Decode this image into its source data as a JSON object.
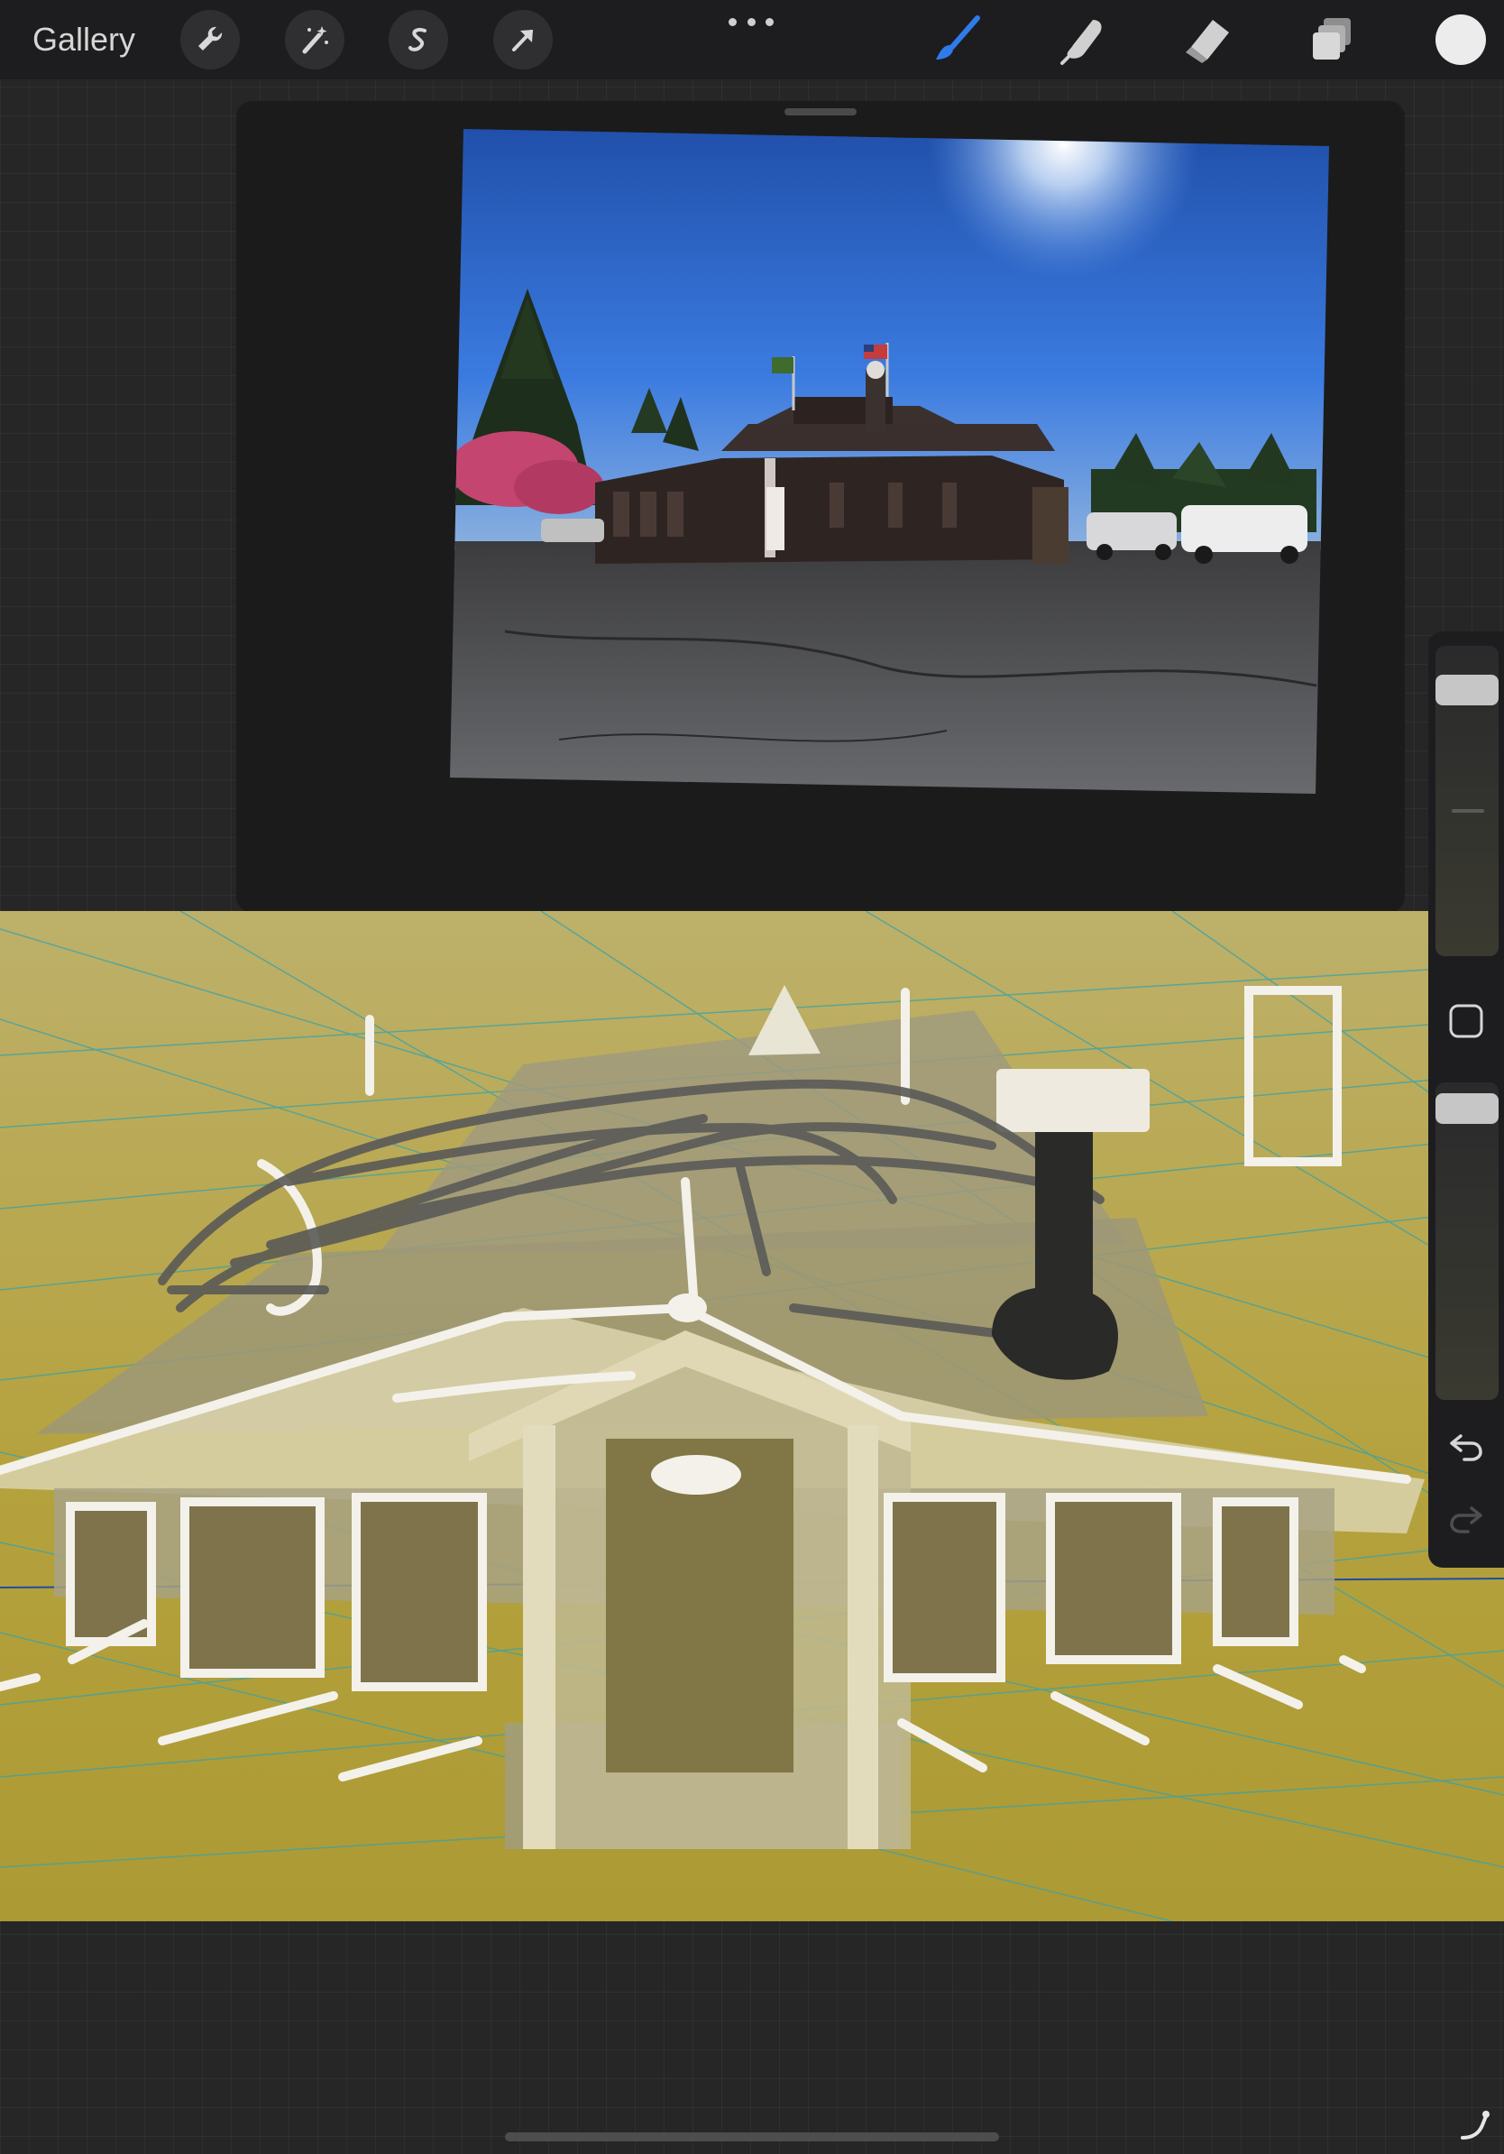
{
  "toolbar": {
    "gallery_label": "Gallery",
    "left_tools": [
      "wrench-icon",
      "magic-wand-icon",
      "selection-icon",
      "transform-arrow-icon"
    ],
    "right_tools": [
      "brush-icon",
      "smudge-icon",
      "eraser-icon",
      "layers-icon"
    ],
    "active_tool": "brush-icon",
    "accent_color": "#2f7bea",
    "current_color": "#ececec"
  },
  "reference_panel": {
    "window": "reference",
    "content": "photo"
  },
  "canvas": {
    "background_color": "#b5a23e"
  },
  "sidebar": {
    "brush_size_level": 0.1,
    "opacity_level": 0.0,
    "buttons": [
      "modify-button",
      "undo-button",
      "redo-button"
    ]
  }
}
